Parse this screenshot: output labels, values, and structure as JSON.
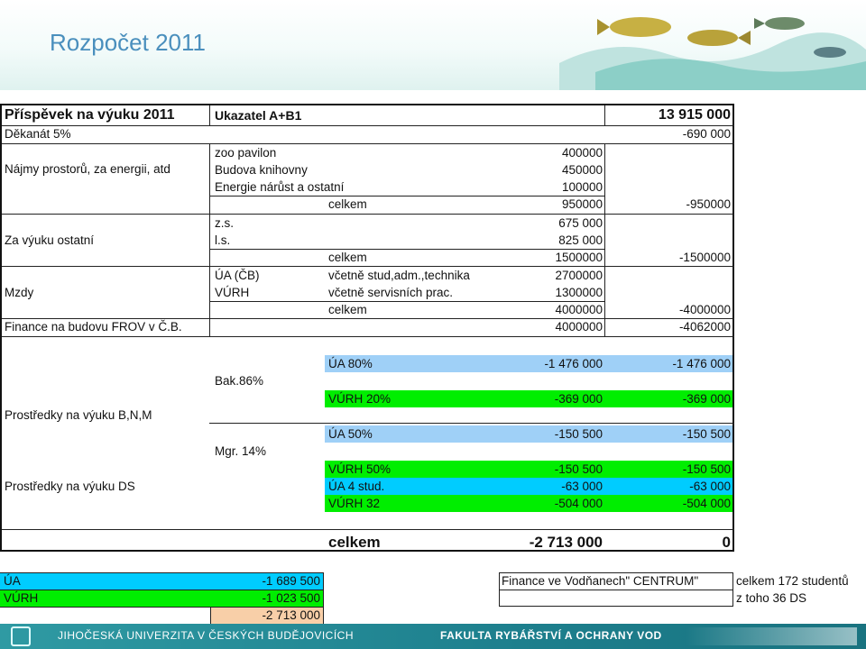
{
  "slide_title": "Rozpočet 2011",
  "colors": {
    "accent_title": "#4a8fbd",
    "ua_blue": "#9fd0f7",
    "vurh_green": "#00ee00",
    "cyan": "#00ccff",
    "peach": "#f8cfa8",
    "footer": "#1d7f8d"
  },
  "icons": {
    "header_art": "fish-illustration",
    "footer_logo": "university-logo-icon"
  },
  "header_row": {
    "label": "Příspěvek na výuku 2011",
    "indicator": "Ukazatel  A+B1",
    "total": "13 915 000"
  },
  "dean": {
    "label": "Děkanát 5%",
    "value": "-690 000"
  },
  "rent": {
    "label": "Nájmy prostorů, za energii, atd",
    "items": [
      {
        "name": "zoo pavilon",
        "value": "400000"
      },
      {
        "name": "Budova knihovny",
        "value": "450000"
      },
      {
        "name": "Energie nárůst a ostatní",
        "value": "100000"
      }
    ],
    "total_label": "celkem",
    "total_value": "950000",
    "total_right": "-950000"
  },
  "teaching_other": {
    "label": "Za výuku ostatní",
    "items": [
      {
        "name": "z.s.",
        "value": "675 000"
      },
      {
        "name": "l.s.",
        "value": "825 000"
      }
    ],
    "total_label": "celkem",
    "total_value": "1500000",
    "total_right": "-1500000"
  },
  "wages": {
    "label": "Mzdy",
    "items": [
      {
        "unit": "ÚA (ČB)",
        "note": "včetně stud,adm.,technika",
        "value": "2700000"
      },
      {
        "unit": "VÚRH",
        "note": "včetně servisních prac.",
        "value": "1300000"
      }
    ],
    "total_label": "celkem",
    "total_value": "4000000",
    "total_right": "-4000000"
  },
  "finance_building": {
    "label": "Finance na budovu FROV v Č.B.",
    "value": "4000000",
    "right": "-4062000"
  },
  "bnm": {
    "label": "Prostředky na výuku B,N,M",
    "bak_label": "Bak.86%",
    "mgr_label": "Mgr. 14%",
    "rows": [
      {
        "name": "ÚA 80%",
        "value": "-1 476 000",
        "right": "-1 476 000"
      },
      {
        "name": "VÚRH 20%",
        "value": "-369 000",
        "right": "-369 000"
      },
      {
        "name": "ÚA 50%",
        "value": "-150 500",
        "right": "-150 500"
      },
      {
        "name": "VÚRH 50%",
        "value": "-150 500",
        "right": "-150 500"
      }
    ]
  },
  "ds": {
    "label": "Prostředky na výuku DS",
    "rows": [
      {
        "name": "ÚA 4 stud.",
        "value": "-63 000",
        "right": "-63 000"
      },
      {
        "name": "VÚRH 32",
        "value": "-504 000",
        "right": "-504 000"
      }
    ]
  },
  "grand_total": {
    "label": "celkem",
    "value": "-2 713 000",
    "right": "0"
  },
  "summary": [
    {
      "label": "ÚA",
      "value": "-1 689 500"
    },
    {
      "label": "VÚRH",
      "value": "-1 023 500"
    },
    {
      "label": "",
      "value": "-2 713 000"
    }
  ],
  "centrum": {
    "label": "Finance ve Vodňanech\" CENTRUM\"",
    "students_total": "celkem 172 studentů",
    "students_ds": "z toho 36 DS"
  },
  "footer": {
    "university": "JIHOČESKÁ UNIVERZITA V ČESKÝCH BUDĚJOVICÍCH",
    "faculty": "FAKULTA RYBÁŘSTVÍ A OCHRANY VOD"
  }
}
